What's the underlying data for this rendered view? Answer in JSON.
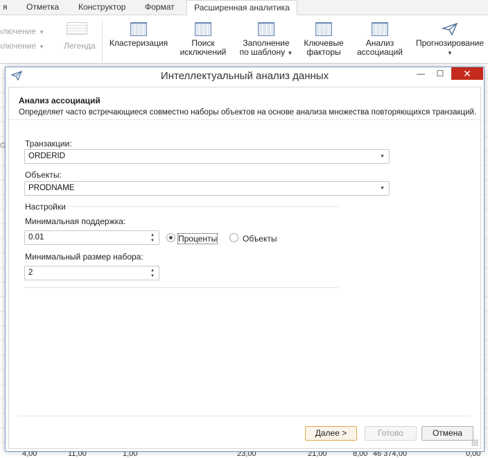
{
  "ribbon": {
    "tabs": [
      {
        "label": "я"
      },
      {
        "label": "Отметка"
      },
      {
        "label": "Конструктор"
      },
      {
        "label": "Формат"
      },
      {
        "label": "Расширенная аналитика"
      }
    ],
    "small_items": [
      {
        "label": "ключение"
      },
      {
        "label": "ключение"
      },
      {
        "label": "Легенда"
      }
    ],
    "buttons": [
      {
        "line1": "Кластеризация",
        "line2": ""
      },
      {
        "line1": "Поиск",
        "line2": "исключений"
      },
      {
        "line1": "Заполнение",
        "line2": "по шаблону"
      },
      {
        "line1": "Ключевые",
        "line2": "факторы"
      },
      {
        "line1": "Анализ",
        "line2": "ассоциаций"
      },
      {
        "line1": "Прогнозирование",
        "line2": ""
      }
    ]
  },
  "background": {
    "side_letter": "G",
    "bottom_values": [
      "4,00",
      "11,00",
      "1,00",
      "23,00",
      "21,00",
      "8,00",
      "46 374,00",
      "0,00"
    ]
  },
  "dialog": {
    "title": "Интеллектуальный анализ данных",
    "close_glyph": "✕",
    "minimize_glyph": "—",
    "maximize_glyph": "☐",
    "header_title": "Анализ ассоциаций",
    "header_desc": "Определяет часто встречающиеся совместно наборы объектов на основе анализа множества повторяющихся транзакций.",
    "transactions_label": "Транзакции:",
    "transactions_value": "ORDERID",
    "objects_label": "Объекты:",
    "objects_value": "PRODNAME",
    "settings_label": "Настройки",
    "min_support_label": "Минимальная поддержка:",
    "min_support_value": "0.01",
    "radio_percent": "Проценты",
    "radio_objects": "Объекты",
    "min_set_size_label": "Минимальный размер набора:",
    "min_set_size_value": "2",
    "btn_next": "Далее >",
    "btn_done": "Готово",
    "btn_cancel": "Отмена"
  }
}
